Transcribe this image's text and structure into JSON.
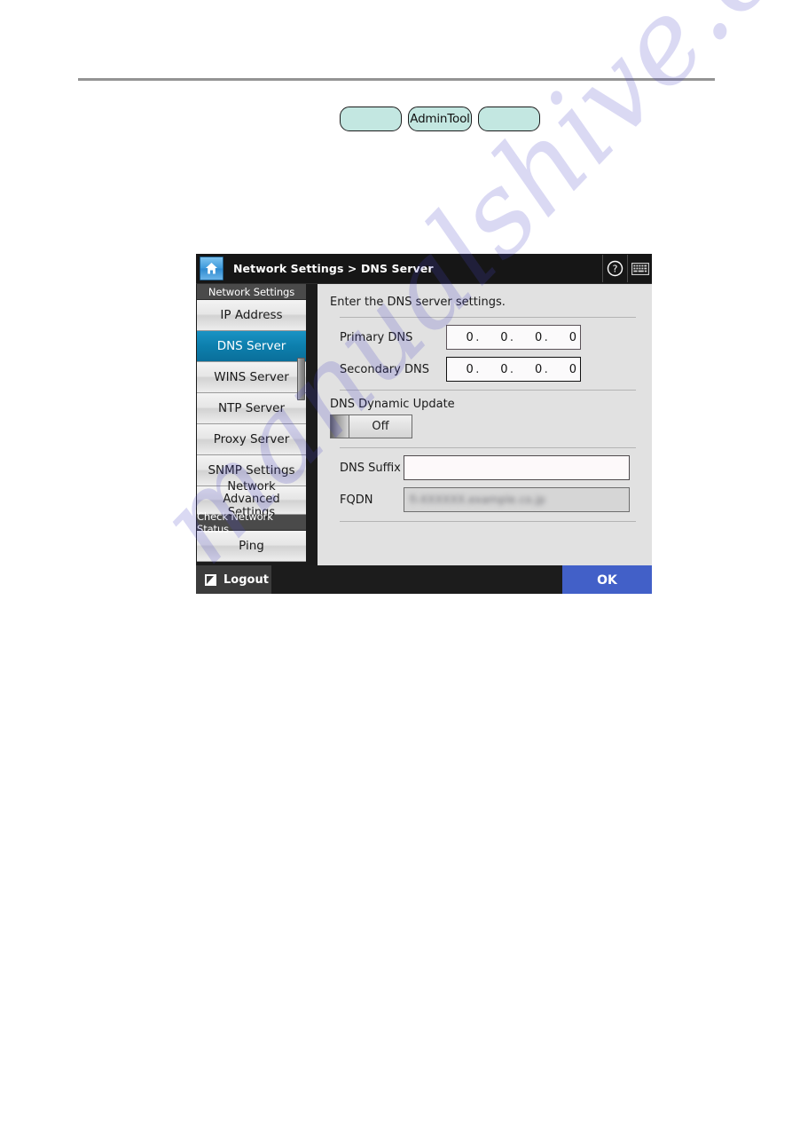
{
  "pills": {
    "left_label": "",
    "center_label": "AdminTool",
    "right_label": ""
  },
  "device": {
    "header": {
      "home_icon": "home-icon",
      "breadcrumb": "Network Settings > DNS Server",
      "help_icon": "help-icon",
      "keyboard_icon": "keyboard-icon"
    },
    "sidebar": {
      "sections": [
        {
          "title": "Network Settings",
          "items": [
            {
              "label": "IP Address",
              "selected": false
            },
            {
              "label": "DNS Server",
              "selected": true
            },
            {
              "label": "WINS Server",
              "selected": false
            },
            {
              "label": "NTP Server",
              "selected": false
            },
            {
              "label": "Proxy Server",
              "selected": false
            },
            {
              "label": "SNMP Settings",
              "selected": false
            },
            {
              "label": "Network Advanced Settings",
              "selected": false
            }
          ]
        },
        {
          "title": "Check Network Status",
          "items": [
            {
              "label": "Ping",
              "selected": false
            }
          ]
        }
      ]
    },
    "content": {
      "intro": "Enter the DNS server settings.",
      "primary_dns": {
        "label": "Primary DNS",
        "octet1": "0",
        "octet2": "0",
        "octet3": "0",
        "octet4": "0",
        "separator": "."
      },
      "secondary_dns": {
        "label": "Secondary DNS",
        "octet1": "0",
        "octet2": "0",
        "octet3": "0",
        "octet4": "0",
        "separator": "."
      },
      "dynamic_update": {
        "label": "DNS Dynamic Update",
        "state": "Off"
      },
      "dns_suffix": {
        "label": "DNS Suffix",
        "value": ""
      },
      "fqdn": {
        "label": "FQDN",
        "value": "fi-XXXXXX.example.co.jp"
      }
    },
    "footer": {
      "logout_label": "Logout",
      "logout_icon": "logout-icon",
      "ok_label": "OK"
    }
  },
  "watermark": {
    "text": "manualshive.com"
  },
  "colors": {
    "accent_selected": "#0d7fad",
    "ok_button": "#4260c8",
    "pill_fill": "#c3e7e1",
    "panel_dark": "#1b1b1b",
    "content_bg": "#e1e1e1"
  }
}
